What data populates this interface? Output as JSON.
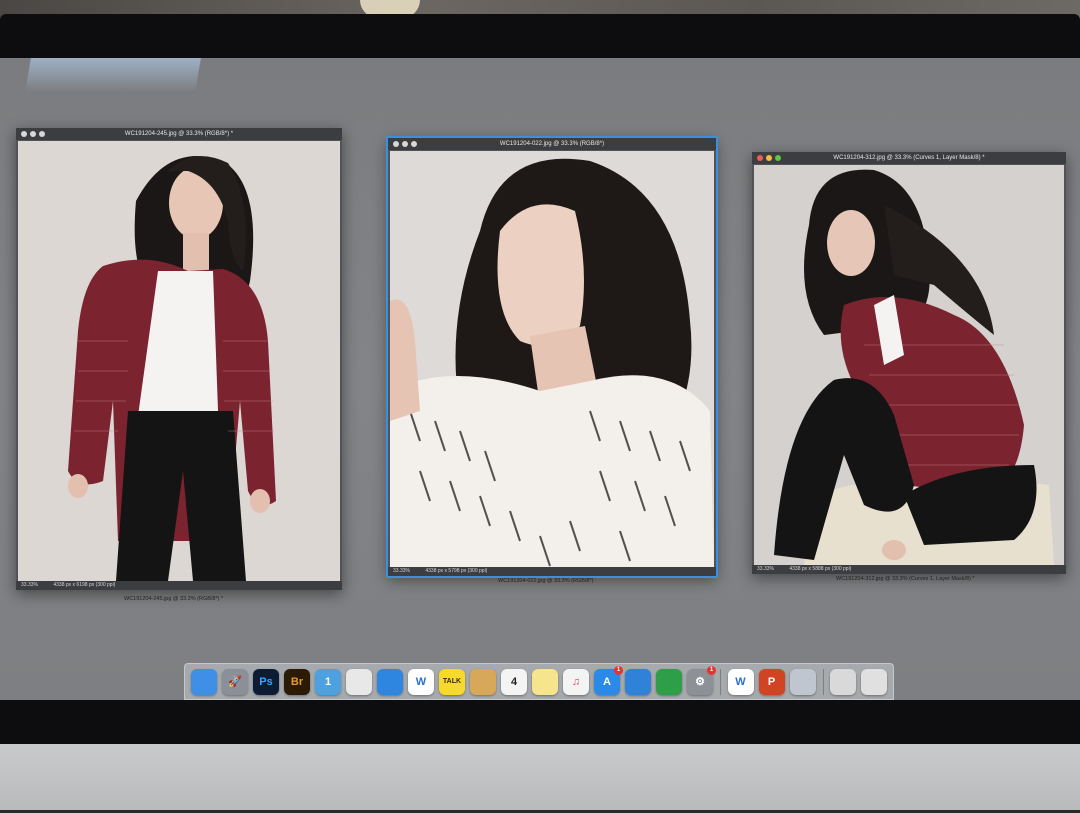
{
  "windows": [
    {
      "title": "WC191204-245.jpg @ 33.3% (RGB/8*) *",
      "zoom": "33.33%",
      "dims": "4338 px x 6198 px (300 ppi)",
      "caption": "WC191204-245.jpg @ 33.3% (RGB/8*) *"
    },
    {
      "title": "WC191204-022.jpg @ 33.3% (RGB/8*)",
      "zoom": "33.33%",
      "dims": "4338 px x 5798 px (300 ppi)",
      "caption": "WC191204-022.jpg @ 33.3% (RGB/8*)"
    },
    {
      "title": "WC191204-312.jpg @ 33.3% (Curves 1, Layer Mask/8) *",
      "zoom": "33.33%",
      "dims": "4338 px x 5888 px (300 ppi)",
      "caption": "WC191204-312.jpg @ 33.3% (Curves 1, Layer Mask/8) *"
    }
  ],
  "dock": {
    "items": [
      {
        "icon": "finder-icon",
        "label": "",
        "color": "#3f8fe6"
      },
      {
        "icon": "launchpad-icon",
        "label": "🚀",
        "color": "#8a8f98"
      },
      {
        "icon": "photoshop-icon",
        "label": "Ps",
        "color": "#0b1c33"
      },
      {
        "icon": "bridge-icon",
        "label": "Br",
        "color": "#2b1a05"
      },
      {
        "icon": "one-password-icon",
        "label": "1",
        "color": "#4ea1e0"
      },
      {
        "icon": "chrome-icon",
        "label": "",
        "color": "#e8e8e8"
      },
      {
        "icon": "safari-icon",
        "label": "",
        "color": "#2f86e0"
      },
      {
        "icon": "wunderlist-icon",
        "label": "W",
        "color": "#ffffff"
      },
      {
        "icon": "kakaotalk-icon",
        "label": "TALK",
        "color": "#f7d92a"
      },
      {
        "icon": "folder-icon",
        "label": "",
        "color": "#d8a85a"
      },
      {
        "icon": "calendar-icon",
        "label": "4",
        "color": "#f4f4f4"
      },
      {
        "icon": "notes-icon",
        "label": "",
        "color": "#f6e58c"
      },
      {
        "icon": "music-icon",
        "label": "♫",
        "color": "#f4f4f4"
      },
      {
        "icon": "app-store-icon",
        "label": "A",
        "color": "#2b8ae8",
        "badge": "1"
      },
      {
        "icon": "keynote-icon",
        "label": "",
        "color": "#2f82d8"
      },
      {
        "icon": "numbers-icon",
        "label": "",
        "color": "#2f9e48"
      },
      {
        "icon": "system-preferences-icon",
        "label": "⚙",
        "color": "#8d9096",
        "badge": "1"
      },
      {
        "icon": "wunderlist-2-icon",
        "label": "W",
        "color": "#ffffff"
      },
      {
        "icon": "powerpoint-icon",
        "label": "P",
        "color": "#d04423"
      },
      {
        "icon": "preview-icon",
        "label": "",
        "color": "#bfc6cf"
      },
      {
        "icon": "downloads-icon",
        "label": "",
        "color": "#d9d9d9"
      },
      {
        "icon": "trash-icon",
        "label": "",
        "color": "#e0e0e0"
      }
    ]
  },
  "colors": {
    "active_window_outline": "#3a8fe0",
    "desktop": "#7d7f82",
    "jacket": "#7b2430",
    "hair": "#1b1716"
  }
}
